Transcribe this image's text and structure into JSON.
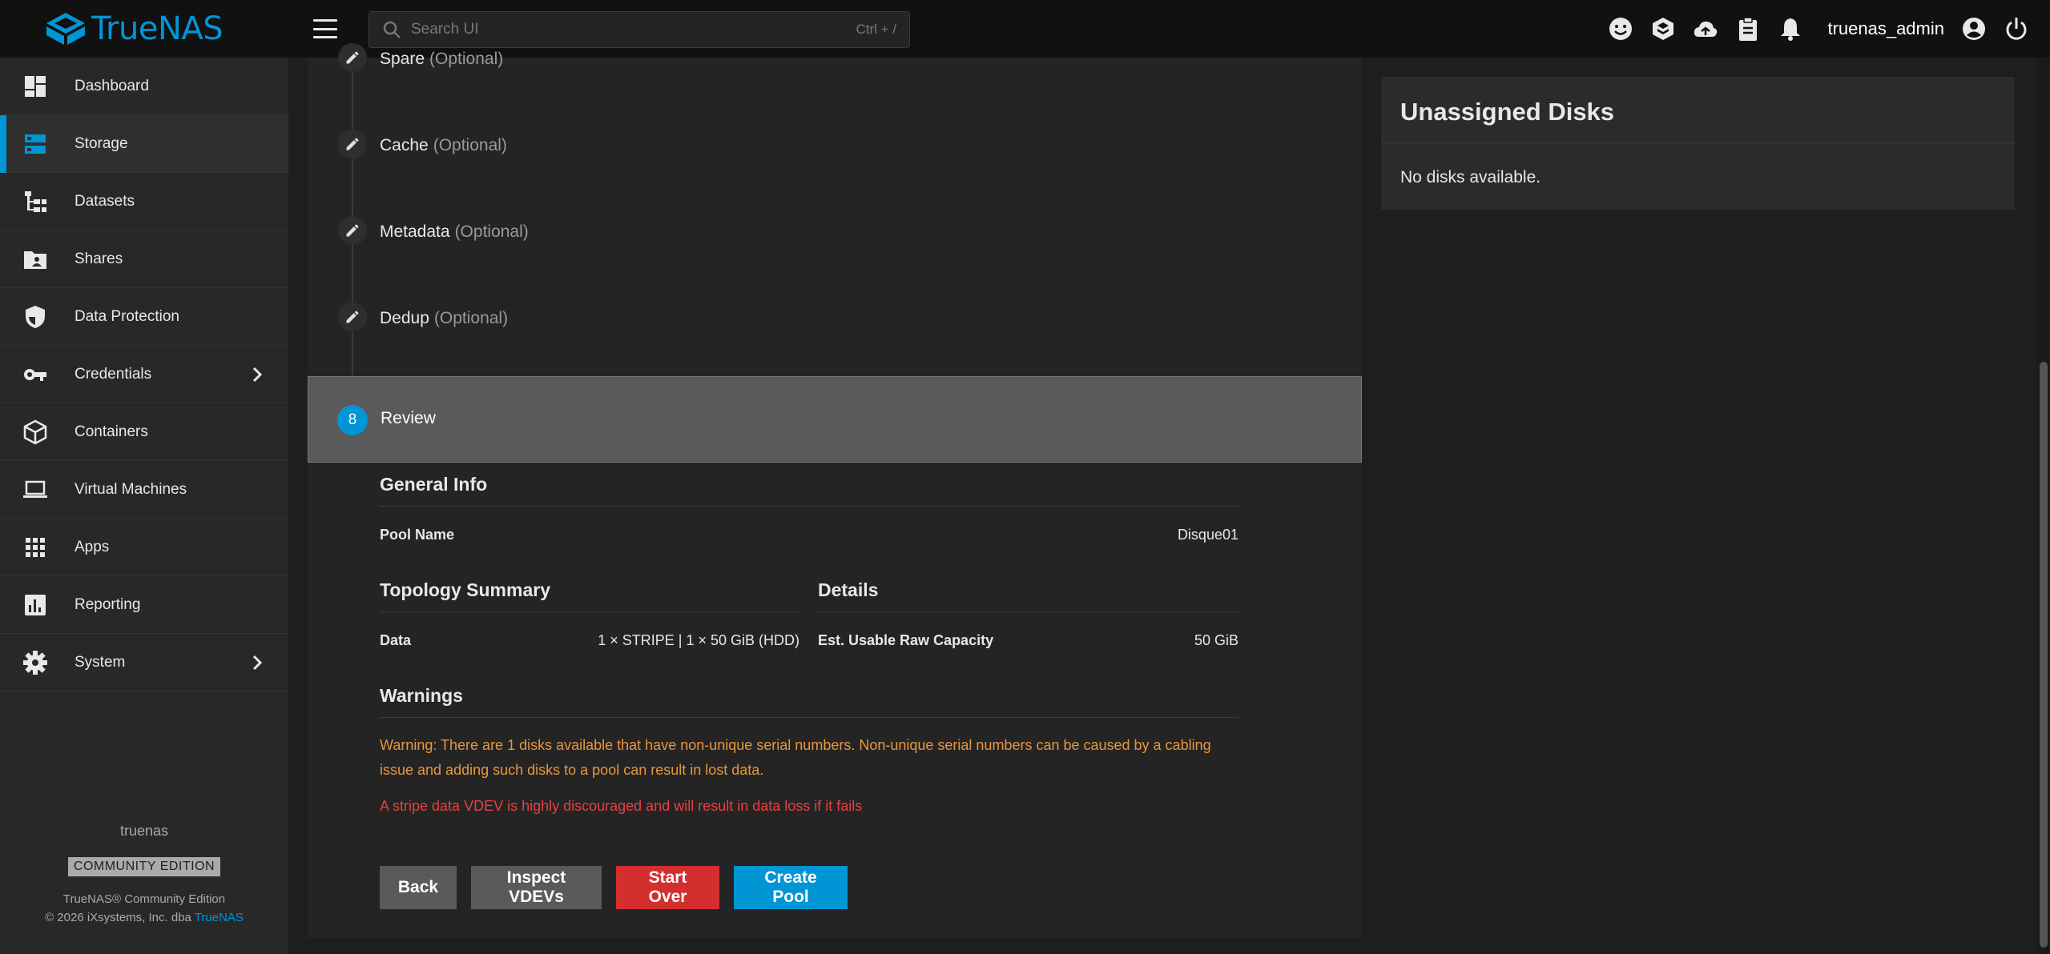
{
  "app": {
    "name": "TrueNAS"
  },
  "search": {
    "placeholder": "Search UI",
    "shortcut": "Ctrl + /"
  },
  "topbar": {
    "username": "truenas_admin"
  },
  "sidebar": {
    "items": [
      {
        "label": "Dashboard",
        "icon": "dashboard-icon"
      },
      {
        "label": "Storage",
        "icon": "storage-icon",
        "active": true
      },
      {
        "label": "Datasets",
        "icon": "datasets-icon"
      },
      {
        "label": "Shares",
        "icon": "shares-icon"
      },
      {
        "label": "Data Protection",
        "icon": "shield-icon"
      },
      {
        "label": "Credentials",
        "icon": "key-icon",
        "expandable": true
      },
      {
        "label": "Containers",
        "icon": "cube-icon"
      },
      {
        "label": "Virtual Machines",
        "icon": "laptop-icon"
      },
      {
        "label": "Apps",
        "icon": "apps-grid-icon"
      },
      {
        "label": "Reporting",
        "icon": "chart-icon"
      },
      {
        "label": "System",
        "icon": "gear-icon",
        "expandable": true
      }
    ],
    "hostname": "truenas",
    "edition_badge": "COMMUNITY EDITION",
    "copyright_line1": "TrueNAS® Community Edition",
    "copyright_line2_prefix": "© 2026 iXsystems, Inc. dba ",
    "copyright_link": "TrueNAS"
  },
  "steps": {
    "items": [
      {
        "label": "Spare",
        "optional": "(Optional)"
      },
      {
        "label": "Cache",
        "optional": "(Optional)"
      },
      {
        "label": "Metadata",
        "optional": "(Optional)"
      },
      {
        "label": "Dedup",
        "optional": "(Optional)"
      }
    ],
    "review": {
      "number": "8",
      "label": "Review"
    }
  },
  "review": {
    "general_info_title": "General Info",
    "pool_name_label": "Pool Name",
    "pool_name_value": "Disque01",
    "topology_title": "Topology Summary",
    "data_label": "Data",
    "data_value": "1 × STRIPE | 1 × 50 GiB (HDD)",
    "details_title": "Details",
    "capacity_label": "Est. Usable Raw Capacity",
    "capacity_value": "50 GiB",
    "warnings_title": "Warnings",
    "warning_serial": "Warning: There are 1 disks available that have non-unique serial numbers. Non-unique serial numbers can be caused by a cabling issue and adding such disks to a pool can result in lost data.",
    "warning_stripe": "A stripe data VDEV is highly discouraged and will result in data loss if it fails"
  },
  "buttons": {
    "back": "Back",
    "inspect": "Inspect VDEVs",
    "start_over": "Start Over",
    "create_pool": "Create Pool"
  },
  "unassigned": {
    "title": "Unassigned Disks",
    "empty": "No disks available."
  },
  "colors": {
    "accent": "#0095d5",
    "danger": "#d32f2f",
    "warning": "#e8963c",
    "error_text": "#e84040"
  }
}
